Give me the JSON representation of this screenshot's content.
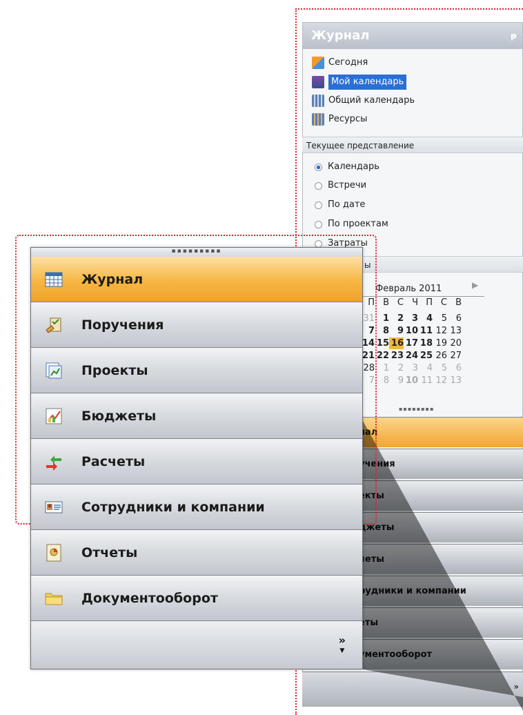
{
  "small_panel": {
    "title": "Журнал",
    "pin": "ᵽ",
    "nav": [
      {
        "label": "Сегодня",
        "icon": "home-calendar-icon",
        "selected": false
      },
      {
        "label": "Мой календарь",
        "icon": "my-calendar-icon",
        "selected": true
      },
      {
        "label": "Общий календарь",
        "icon": "shared-calendar-icon",
        "selected": false
      },
      {
        "label": "Ресурсы",
        "icon": "resources-icon",
        "selected": false
      }
    ],
    "current_view_title": "Текущее представление",
    "views": [
      {
        "label": "Календарь",
        "checked": true
      },
      {
        "label": "Встречи",
        "checked": false
      },
      {
        "label": "По дате",
        "checked": false
      },
      {
        "label": "По проектам",
        "checked": false
      },
      {
        "label": "Затраты",
        "checked": false
      }
    ],
    "filters_title": "ы",
    "calendar": {
      "month": "Февраль 2011",
      "weekdays": [
        "П",
        "В",
        "С",
        "Ч",
        "П",
        "С",
        "В"
      ],
      "rows": [
        [
          "31",
          "1",
          "2",
          "3",
          "4",
          "5",
          "6"
        ],
        [
          "7",
          "8",
          "9",
          "10",
          "11",
          "12",
          "13"
        ],
        [
          "14",
          "15",
          "16",
          "17",
          "18",
          "19",
          "20"
        ],
        [
          "21",
          "22",
          "23",
          "24",
          "25",
          "26",
          "27"
        ],
        [
          "28",
          "1",
          "2",
          "3",
          "4",
          "5",
          "6"
        ],
        [
          "7",
          "8",
          "9",
          "10",
          "11",
          "12",
          "13"
        ]
      ],
      "today": "16"
    },
    "buttons": [
      "нал",
      "учения",
      "екты",
      "джеты",
      "четы",
      "рудники и компании",
      "еты",
      "ументооборот"
    ],
    "more": "»"
  },
  "big_panel": {
    "buttons": [
      {
        "label": "Журнал",
        "icon": "calendar-grid-icon",
        "active": true
      },
      {
        "label": "Поручения",
        "icon": "task-checklist-icon",
        "active": false
      },
      {
        "label": "Проекты",
        "icon": "project-chart-icon",
        "active": false
      },
      {
        "label": "Бюджеты",
        "icon": "budget-chart-icon",
        "active": false
      },
      {
        "label": "Расчеты",
        "icon": "payments-arrows-icon",
        "active": false
      },
      {
        "label": "Сотрудники и компании",
        "icon": "contact-card-icon",
        "active": false
      },
      {
        "label": "Отчеты",
        "icon": "report-document-icon",
        "active": false
      },
      {
        "label": "Документооборот",
        "icon": "folder-icon",
        "active": false
      }
    ],
    "more": "»"
  },
  "colors": {
    "active_orange": "#f2a530",
    "selection_blue": "#2a6fd6",
    "dotted_red": "#d9262e",
    "today_highlight": "#f5b73b"
  }
}
